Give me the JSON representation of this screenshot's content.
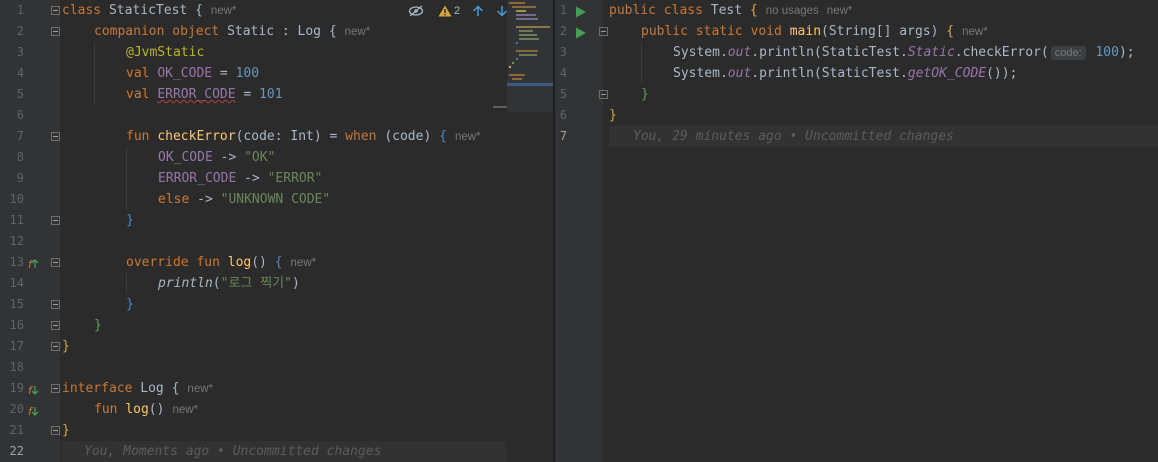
{
  "left_editor": {
    "warning_count": "2",
    "gutter": {
      "line_numbers": [
        "1",
        "2",
        "3",
        "4",
        "5",
        "6",
        "7",
        "8",
        "9",
        "10",
        "11",
        "12",
        "13",
        "14",
        "15",
        "16",
        "17",
        "18",
        "19",
        "20",
        "21",
        "22"
      ]
    },
    "lines": {
      "l1": {
        "t1": "class ",
        "t2": "StaticTest ",
        "t3": "{",
        "hint": "new*"
      },
      "l2": {
        "t1": "companion object ",
        "t2": "Static : Log ",
        "t3": "{",
        "hint": "new*"
      },
      "l3": {
        "t1": "@JvmStatic"
      },
      "l4": {
        "t1": "val ",
        "t2": "OK_CODE",
        "t3": " = ",
        "t4": "100"
      },
      "l5": {
        "t1": "val ",
        "t2": "ERROR_CODE",
        "t3": " = ",
        "t4": "101"
      },
      "l7": {
        "t1": "fun ",
        "t2": "checkError",
        "t3": "(code: Int) = ",
        "t4": "when ",
        "t5": "(code) ",
        "t6": "{",
        "hint": "new*"
      },
      "l8": {
        "t1": "OK_CODE",
        "t2": " -> ",
        "t3": "\"OK\""
      },
      "l9": {
        "t1": "ERROR_CODE",
        "t2": " -> ",
        "t3": "\"ERROR\""
      },
      "l10": {
        "t1": "else ",
        "t2": "-> ",
        "t3": "\"UNKNOWN CODE\""
      },
      "l11": {
        "t1": "}"
      },
      "l13": {
        "t1": "override fun ",
        "t2": "log",
        "t3": "() ",
        "t4": "{",
        "hint": "new*"
      },
      "l14": {
        "t1": "println",
        "t2": "(",
        "t3": "\"로그 찍기\"",
        "t4": ")"
      },
      "l15": {
        "t1": "}"
      },
      "l16": {
        "t1": "}"
      },
      "l17": {
        "t1": "}"
      },
      "l19": {
        "t1": "interface ",
        "t2": "Log ",
        "t3": "{",
        "hint": "new*"
      },
      "l20": {
        "t1": "fun ",
        "t2": "log",
        "t3": "()",
        "hint": "new*"
      },
      "l21": {
        "t1": "}"
      },
      "l22": {
        "blame": "You, Moments ago • Uncommitted changes"
      }
    }
  },
  "right_editor": {
    "gutter": {
      "line_numbers": [
        "1",
        "2",
        "3",
        "4",
        "5",
        "6",
        "7"
      ]
    },
    "lines": {
      "l1": {
        "t1": "public class ",
        "t2": "Test ",
        "t3": "{",
        "usages": "no usages",
        "hint": "new*"
      },
      "l2": {
        "t1": "public static void ",
        "t2": "main",
        "t3": "(String[] args) ",
        "t4": "{",
        "hint": "new*"
      },
      "l3": {
        "t1": "System.",
        "t2": "out",
        "t3": ".println(StaticTest.",
        "t4": "Static",
        "t5": ".checkError(",
        "param": "code:",
        "t6": " 100",
        "t7": ");"
      },
      "l4": {
        "t1": "System.",
        "t2": "out",
        "t3": ".println(StaticTest.",
        "t4": "getOK_CODE",
        "t5": "());"
      },
      "l5": {
        "t1": "}"
      },
      "l6": {
        "t1": "}"
      },
      "l7": {
        "blame": "You, 29 minutes ago • Uncommitted changes"
      }
    }
  },
  "colors": {
    "background": "#2b2b2b",
    "gutter": "#313335",
    "keyword": "#cc7832",
    "function": "#ffc66d",
    "property": "#9876aa",
    "string": "#6a8759",
    "number": "#6897bb",
    "annotation": "#bbb529",
    "run_icon": "#499c54"
  }
}
